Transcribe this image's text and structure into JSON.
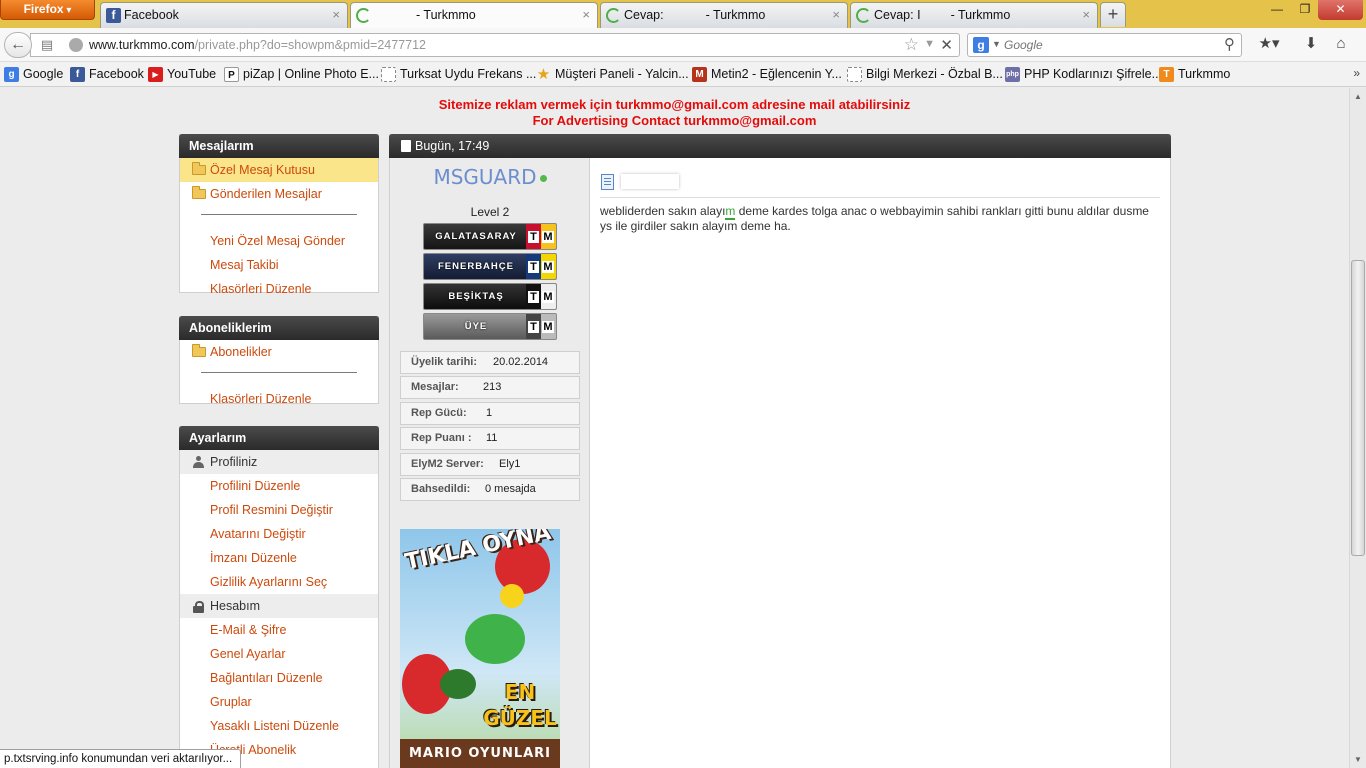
{
  "browser": {
    "menu_button": "Firefox",
    "tabs": [
      {
        "title": "Facebook",
        "icon": "facebook-icon"
      },
      {
        "title": "- Turkmmo",
        "icon": "loading-icon"
      },
      {
        "title": "Cevap:",
        "title_suffix": "- Turkmmo",
        "icon": "loading-icon"
      },
      {
        "title": "Cevap: I",
        "title_suffix": "- Turkmmo",
        "icon": "loading-icon"
      }
    ],
    "new_tab_label": "+",
    "url_domain": "www.turkmmo.com",
    "url_path": "/private.php?do=showpm&pmid=2477712",
    "search_placeholder": "Google",
    "bookmarks": [
      {
        "label": "Google",
        "icon": "google-icon"
      },
      {
        "label": "Facebook",
        "icon": "facebook-icon"
      },
      {
        "label": "YouTube",
        "icon": "youtube-icon"
      },
      {
        "label": "piZap | Online Photo E...",
        "icon": "pizap-icon"
      },
      {
        "label": "Turksat Uydu Frekans ...",
        "icon": "page-icon"
      },
      {
        "label": "Müşteri Paneli - Yalcin...",
        "icon": "star-icon"
      },
      {
        "label": "Metin2 - Eğlencenin Y...",
        "icon": "metin2-icon"
      },
      {
        "label": "Bilgi Merkezi - Özbal B...",
        "icon": "page-icon"
      },
      {
        "label": "PHP Kodlarınızı Şifrele...",
        "icon": "php-icon"
      },
      {
        "label": "Turkmmo",
        "icon": "turkmmo-icon"
      }
    ],
    "status_text": "p.txtsrving.info konumundan veri aktarılıyor..."
  },
  "ad_banner": {
    "line1": "Sitemize reklam vermek için turkmmo@gmail.com adresine mail atabilirsiniz",
    "line2": "For Advertising Contact turkmmo@gmail.com"
  },
  "sidebar": {
    "messages": {
      "title": "Mesajlarım",
      "folders": [
        "Özel Mesaj Kutusu",
        "Gönderilen Mesajlar"
      ],
      "links": [
        "Yeni Özel Mesaj Gönder",
        "Mesaj Takibi",
        "Klasörleri Düzenle"
      ]
    },
    "subscriptions": {
      "title": "Aboneliklerim",
      "folders": [
        "Abonelikler"
      ],
      "links": [
        "Klasörleri Düzenle"
      ]
    },
    "settings": {
      "title": "Ayarlarım",
      "profile_section": "Profiliniz",
      "profile_links": [
        "Profilini Düzenle",
        "Profil Resmini Değiştir",
        "Avatarını Değiştir",
        "İmzanı Düzenle",
        "Gizlilik Ayarlarını Seç"
      ],
      "account_section": "Hesabım",
      "account_links": [
        "E-Mail & Şifre",
        "Genel Ayarlar",
        "Bağlantıları Düzenle",
        "Gruplar",
        "Yasaklı Listeni Düzenle",
        "Ücretli Abonelik"
      ]
    }
  },
  "post": {
    "date": "Bugün, 17:49",
    "username": "MSGUARD",
    "level": "Level 2",
    "badges": [
      {
        "label": "GALATASARAY",
        "bg": "#2b2b2b",
        "tm_colors": [
          "#c8102e",
          "#f6c21b"
        ]
      },
      {
        "label": "FENERBAHÇE",
        "bg": "#22304f",
        "tm_colors": [
          "#143a7b",
          "#f4d600"
        ]
      },
      {
        "label": "BEŞİKTAŞ",
        "bg": "#1a1a1a",
        "tm_colors": [
          "#111111",
          "#ffffff"
        ]
      },
      {
        "label": "ÜYE",
        "bg": "#7a7a7a",
        "tm_colors": [
          "#444444",
          "#bbbbbb"
        ]
      }
    ],
    "badge_tm": [
      "T",
      "M"
    ],
    "info": [
      {
        "label": "Üyelik tarihi:",
        "value": "20.02.2014"
      },
      {
        "label": "Mesajlar:",
        "value": "213"
      },
      {
        "label": "Rep Gücü:",
        "value": "1"
      },
      {
        "label": "Rep Puanı :",
        "value": "11"
      },
      {
        "label": "ElyM2 Server:",
        "value": "Ely1"
      },
      {
        "label": "Bahsedildi:",
        "value": "0 mesajda"
      }
    ],
    "ad": {
      "top_text": "TIKLA OYNA",
      "mid_text": "EN GÜZEL",
      "bottom_text": "MARIO OYUNLARI"
    },
    "message_pre": "webliderden sakın alayı",
    "message_mark": "m",
    "message_post": " deme kardes tolga anac o webbayimin sahibi rankları gitti bunu aldılar dusme ys ile girdiler sakın alayım deme ha."
  },
  "colors": {
    "link": "#cc4a0d",
    "ad_red": "#e40b0b",
    "username": "#6b8ecf",
    "header_dark": "#2a2a2a",
    "active_item": "#fbe58a"
  }
}
